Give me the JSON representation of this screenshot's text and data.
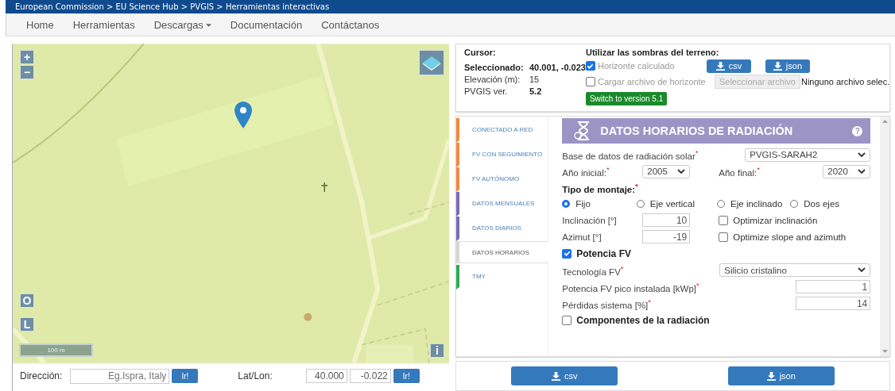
{
  "breadcrumb": "European Commission > EU Science Hub > PVGIS > Herramientas interactivas",
  "nav": [
    {
      "label": "Home",
      "dropdown": false
    },
    {
      "label": "Herramientas",
      "dropdown": false
    },
    {
      "label": "Descargas",
      "dropdown": true
    },
    {
      "label": "Documentación",
      "dropdown": false
    },
    {
      "label": "Contáctanos",
      "dropdown": false
    }
  ],
  "map": {
    "kind": "picture",
    "zoom_in": "+",
    "zoom_out": "−",
    "buttons": [
      "O",
      "L"
    ],
    "info": "i",
    "scale": "100 m",
    "address": {
      "label": "Dirección:",
      "placeholder": "Eg.Ispra, Italy",
      "go": "Ir!"
    },
    "latlon": {
      "label": "Lat/Lon:",
      "lat": "40.000",
      "lon": "-0.022",
      "go": "Ir!"
    }
  },
  "info": {
    "cursor": "Cursor:",
    "selected_label": "Seleccionado:",
    "selected_value": "40.001, -0.023",
    "elevation_label": "Elevación (m):",
    "elevation_value": "15",
    "version_label": "PVGIS ver.",
    "version_value": "5.2",
    "shadows_title": "Utilizar las sombras del terreno:",
    "horizon_calc": {
      "label": "Horizonte calculado",
      "checked": true
    },
    "horizon_file": {
      "label": "Cargar archivo de horizonte",
      "checked": false
    },
    "downloads": [
      "csv",
      "json"
    ],
    "file_button": "Seleccionar archivo",
    "file_status": "Ninguno archivo selec.",
    "switch_button": "Switch to version 5.1"
  },
  "tabs": [
    {
      "label": "CONECTADO A RED",
      "color": "#f08a3c",
      "selected": false
    },
    {
      "label": "FV CON SEGUIMIENTO",
      "color": "#f08a3c",
      "selected": false
    },
    {
      "label": "FV AUTÓNOMO",
      "color": "#f08a3c",
      "selected": false
    },
    {
      "label": "DATOS MENSUALES",
      "color": "#7b6bb5",
      "selected": false
    },
    {
      "label": "DATOS DIARIOS",
      "color": "#7b6bb5",
      "selected": false
    },
    {
      "label": "DATOS HORARIOS",
      "color": "#d6d6d6",
      "selected": true
    },
    {
      "label": "TMY",
      "color": "#2eaa55",
      "selected": false
    }
  ],
  "form": {
    "title": "DATOS HORARIOS DE RADIACIÓN",
    "help": "?",
    "database": {
      "label": "Base de datos de radiación solar$^{*}$",
      "value": "PVGIS-SARAH2"
    },
    "start_year": {
      "label": "Año inicial:$^{*}$",
      "value": "2005"
    },
    "end_year": {
      "label": "Año final:$^{*}$",
      "value": "2020"
    },
    "mounting_title": "Tipo de montaje:$^{*}$",
    "mounting": [
      {
        "label": "Fijo",
        "selected": true
      },
      {
        "label": "Eje vertical",
        "selected": false
      },
      {
        "label": "Eje inclinado",
        "selected": false
      },
      {
        "label": "Dos ejes",
        "selected": false
      }
    ],
    "slope": {
      "label": "Inclinación [°]",
      "value": "10",
      "option": {
        "label": "Optimizar inclinación",
        "checked": false
      }
    },
    "azimuth": {
      "label": "Azimut [°]",
      "value": "-19",
      "option": {
        "label": "Optimize slope and azimuth",
        "checked": false
      }
    },
    "pv_power": {
      "label": "Potencia FV",
      "checked": true
    },
    "technology": {
      "label": "Tecnología FV$^{*}$",
      "value": "Silicio cristalino"
    },
    "peak_power": {
      "label": "Potencia FV pico instalada [kWp]$^{*}$",
      "value": "1"
    },
    "losses": {
      "label": "Pérdidas sistema [%]$^{*}$",
      "value": "14"
    },
    "components": {
      "label": "Componentes de la radiación",
      "checked": false
    }
  },
  "downloads": [
    "csv",
    "json"
  ]
}
